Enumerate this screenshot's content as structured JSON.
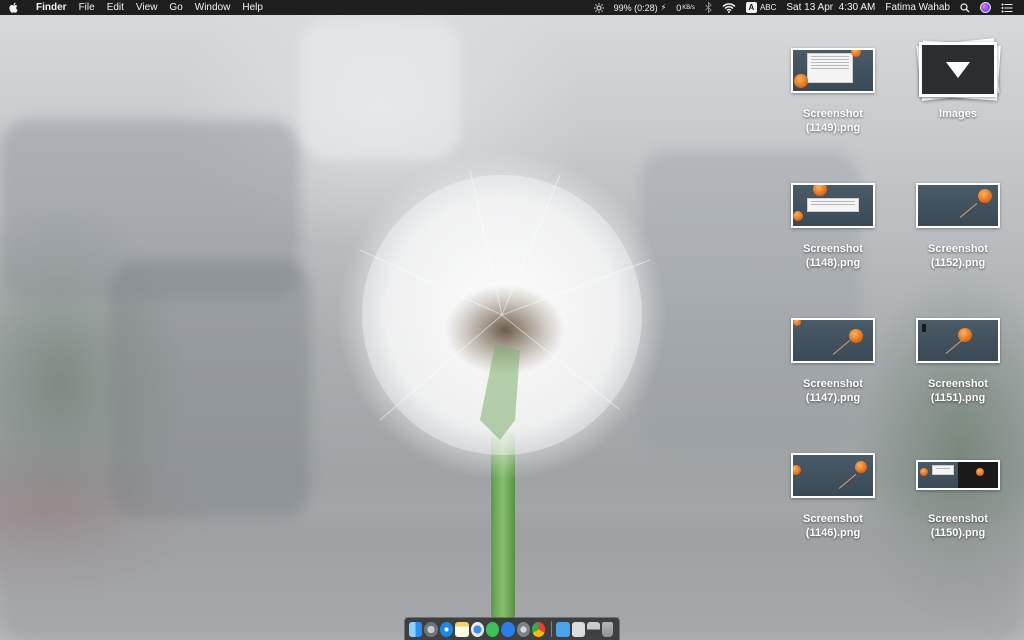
{
  "menubar": {
    "apple_icon": "apple-logo-icon",
    "app_name": "Finder",
    "menus": [
      "File",
      "Edit",
      "View",
      "Go",
      "Window",
      "Help"
    ],
    "battery": "99% (0:28)",
    "network_speed": "0",
    "network_unit": "KB/s",
    "input_source": "ABC",
    "input_source_badge": "A",
    "datetime": "Sat 13 Apr  4:30 AM",
    "user": "Fatima Wahab"
  },
  "desktop_items": [
    {
      "name": "Screenshot (1149).png",
      "line1": "Screenshot",
      "line2": "(1149).png",
      "type": "image"
    },
    {
      "name": "Images",
      "line1": "Images",
      "line2": "",
      "type": "folder",
      "icon": "folder-download-icon"
    },
    {
      "name": "Screenshot (1148).png",
      "line1": "Screenshot",
      "line2": "(1148).png",
      "type": "image"
    },
    {
      "name": "Screenshot (1152).png",
      "line1": "Screenshot",
      "line2": "(1152).png",
      "type": "image"
    },
    {
      "name": "Screenshot (1147).png",
      "line1": "Screenshot",
      "line2": "(1147).png",
      "type": "image"
    },
    {
      "name": "Screenshot (1151).png",
      "line1": "Screenshot",
      "line2": "(1151).png",
      "type": "image"
    },
    {
      "name": "Screenshot (1146).png",
      "line1": "Screenshot",
      "line2": "(1146).png",
      "type": "image"
    },
    {
      "name": "Screenshot (1150).png",
      "line1": "Screenshot",
      "line2": "(1150).png",
      "type": "image"
    }
  ],
  "dock": {
    "apps": [
      {
        "icon": "finder-icon",
        "color": "#2f8cf0"
      },
      {
        "icon": "launchpad-icon",
        "color": "#8a8f96"
      },
      {
        "icon": "safari-icon",
        "color": "#1e88e5"
      },
      {
        "icon": "notes-icon",
        "color": "#f3d36b"
      },
      {
        "icon": "photo-booth-icon",
        "color": "#e9e9e9"
      },
      {
        "icon": "messages-icon",
        "color": "#3fbf5a"
      },
      {
        "icon": "app-store-icon",
        "color": "#2b7de9"
      },
      {
        "icon": "system-preferences-icon",
        "color": "#7d838a"
      },
      {
        "icon": "chrome-icon",
        "color": "#e94235"
      }
    ],
    "right_items": [
      {
        "icon": "downloads-folder-icon",
        "color": "#4aa3e8"
      },
      {
        "icon": "document-stack-icon",
        "color": "#d9dde0"
      },
      {
        "icon": "screenshot-stack-icon",
        "color": "#c7cbcf"
      },
      {
        "icon": "trash-icon",
        "color": "#8d9196"
      }
    ]
  }
}
